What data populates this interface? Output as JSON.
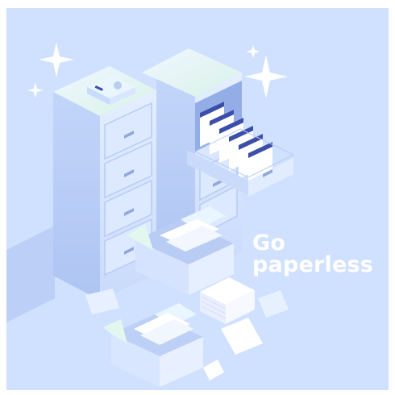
{
  "illustration": {
    "headline_line1": "Go",
    "headline_line2": "paperless"
  },
  "colors": {
    "background": "#cfe1ff",
    "cabinet_light": "#e6f0ff",
    "cabinet_mid": "#c6d8fb",
    "cabinet_dark": "#a9c0ee",
    "folder_tab": "#3b4ea8",
    "paper": "#ffffff",
    "text": "#ffffff"
  }
}
